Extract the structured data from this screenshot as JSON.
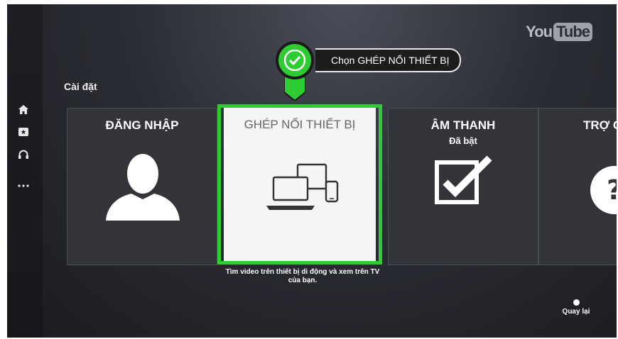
{
  "app": {
    "logo_you": "You",
    "logo_tube": "Tube"
  },
  "sidebar": {
    "items": [
      {
        "icon": "home-icon"
      },
      {
        "icon": "subscriptions-icon"
      },
      {
        "icon": "headphones-icon"
      },
      {
        "icon": "more-icon"
      }
    ]
  },
  "settings": {
    "title": "Cài đặt",
    "tiles": [
      {
        "title": "ĐĂNG NHẬP",
        "subtitle": "",
        "icon": "person-icon"
      },
      {
        "title": "GHÉP NỐI THIẾT BỊ",
        "subtitle": "",
        "icon": "devices-icon",
        "focused": true
      },
      {
        "title": "ÂM THANH",
        "subtitle": "Đã bật",
        "icon": "checkbox-checked-icon"
      },
      {
        "title": "TRỢ G",
        "subtitle": "",
        "icon": "help-icon"
      }
    ],
    "description": "Tìm video trên thiết bị di động và xem trên TV của bạn."
  },
  "callout": {
    "text": "Chọn GHÉP NỐI THIẾT BỊ",
    "icon": "check-icon",
    "color": "#2ecc32"
  },
  "footer": {
    "back_label": "Quay lại"
  },
  "colors": {
    "focus": "#2ecc32",
    "background": "#2b2d34"
  }
}
